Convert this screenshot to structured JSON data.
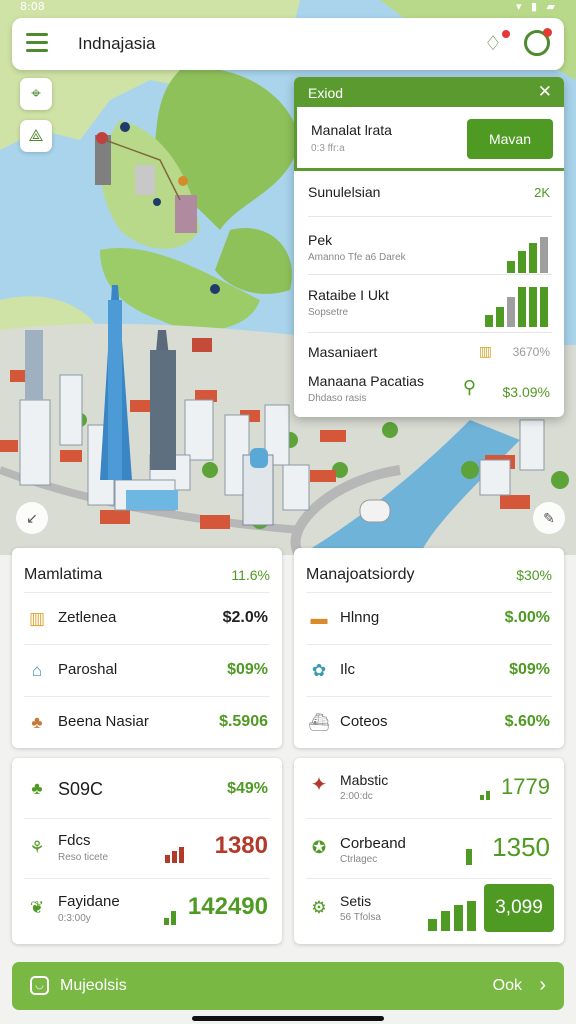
{
  "status_bar": {
    "time": "8:08",
    "icons": "▾ ▮ ▰"
  },
  "header": {
    "title": "Indnajasia"
  },
  "map_controls": {
    "locate": "⌖",
    "navigate": "⟁"
  },
  "popup": {
    "title": "Exiod",
    "featured": {
      "name": "Manalat lrata",
      "sub": "0:3 ffr:a",
      "button": "Mavan"
    },
    "rows": [
      {
        "name": "Sunulelsian",
        "sub": "",
        "value": "2K"
      },
      {
        "name": "Pek",
        "sub": "Amanno  Tfe a6 Darek",
        "value": ""
      },
      {
        "name": "Rataibe I Ukt",
        "sub": "Sopsetre",
        "value": ""
      },
      {
        "name": "Masaniaert",
        "sub": "",
        "value": "3670%"
      },
      {
        "name": "Manaana Pacatias",
        "sub": "Dhdaso rasis",
        "value": "$3.09%"
      }
    ]
  },
  "card_left_top": {
    "title": "Mamlatima",
    "title_value": "11.6%",
    "rows": [
      {
        "icon": "building-icon",
        "label": "Zetlenea",
        "value": "$2.0%"
      },
      {
        "icon": "shop-icon",
        "label": "Paroshal",
        "value": "$09%"
      },
      {
        "icon": "market-icon",
        "label": "Beena Nasiar",
        "value": "$.5906"
      }
    ]
  },
  "card_right_top": {
    "title": "Manajoatsiordy",
    "title_value": "$30%",
    "rows": [
      {
        "icon": "mailbox-icon",
        "label": "Hlnng",
        "value": "$.00%"
      },
      {
        "icon": "flower-icon",
        "label": "Ilc",
        "value": "$09%"
      },
      {
        "icon": "ship-icon",
        "label": "Coteos",
        "value": "$.60%"
      }
    ]
  },
  "card_left_bottom": {
    "rows": [
      {
        "icon": "tree-icon",
        "label": "S09C",
        "sub": "",
        "value": "$49%"
      },
      {
        "icon": "plant-icon",
        "label": "Fdcs",
        "sub": "Reso ticete",
        "value": "1380"
      },
      {
        "icon": "leaf-icon",
        "label": "Fayidane",
        "sub": "0:3:00y",
        "value": "142490"
      }
    ]
  },
  "card_right_bottom": {
    "rows": [
      {
        "icon": "deer-icon",
        "label": "Mabstic",
        "sub": "2:00:dc",
        "value": "1779"
      },
      {
        "icon": "badge-icon",
        "label": "Corbeand",
        "sub": "Ctrlagec",
        "value": "1350"
      },
      {
        "icon": "gear-icon",
        "label": "Setis",
        "sub": "56 Tfolsa",
        "value": "3,099"
      }
    ]
  },
  "bottom_bar": {
    "label": "Mujeolsis",
    "action": "Ook"
  },
  "colors": {
    "accent": "#4f9a23",
    "header": "#5a9a2e",
    "bottom": "#78b843"
  }
}
